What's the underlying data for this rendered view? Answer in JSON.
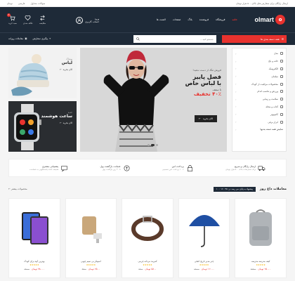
{
  "topbar": {
    "right_text": "ارسال رایگان برای سفارش های بالای ۵۰۰ هزار تومان",
    "currency": "تومان",
    "language": "فارسی",
    "help": "سوالات متداول"
  },
  "header": {
    "logo_badge": "o",
    "logo_text": "olmart",
    "nav": [
      {
        "label": "خانه",
        "hot": true
      },
      {
        "label": "فروشگاه"
      },
      {
        "label": "فروشنده"
      },
      {
        "label": "بلاگ"
      },
      {
        "label": "صفحات"
      },
      {
        "label": "المنت ها"
      }
    ],
    "account_line1": "ورود",
    "account_line2": "حساب کاربری",
    "icons": [
      {
        "name": "compare-icon",
        "label": "مقایسه"
      },
      {
        "name": "wishlist-icon",
        "label": "علاقه مندی"
      },
      {
        "name": "cart-icon",
        "label": "سبد خرید",
        "badge": "0"
      }
    ]
  },
  "searchrow": {
    "category_button": "همه دسته بندی ها",
    "search_placeholder": "جستجو کنید ...",
    "links": [
      "پیگیری سفارش",
      "معاملات روزانه"
    ]
  },
  "categories": [
    "مدل",
    "خانه و باغ",
    "الکترونیک",
    "مبلمان",
    "محصولات مراقبت از کودک",
    "ورزش و تناسب اندام",
    "سلامت و زیبایی",
    "کتاب و مجله",
    "کامپیوتر",
    "ابزار برقی",
    "نمایش همه دسته بندیها"
  ],
  "hero": {
    "subtitle": "فروش مگا، از دست ندهید!",
    "title_line1": "فصل پاییز",
    "title_line2": "با لباس خاص",
    "pct_prefix": "تا سقف",
    "pct_value": "۴۰٪ تخفیف",
    "button": "الان بخرید",
    "active_slide": 1,
    "slides": 3
  },
  "promo1": {
    "small": "پوشاک",
    "big": "لباس",
    "cta": "الان بخرید"
  },
  "promo2": {
    "small": "جدید",
    "big": "ساعت هوشمند",
    "cta": "الان بخرید"
  },
  "features": [
    {
      "title": "ارسال رایگان و سریع",
      "sub": "برای سفارشات بالای ۵۰۰ هزار تومان",
      "icon": "truck-icon"
    },
    {
      "title": "پرداخت امن",
      "sub": "۱۰۰٪ پرداخت امن تضمینی",
      "icon": "lock-icon"
    },
    {
      "title": "ضمانت بازگشت پول",
      "sub": "تا ۳۰ روز بازگشت پول",
      "icon": "refund-icon"
    },
    {
      "title": "پشتیبانی مشتری",
      "sub": "همیشه آماده پاسخگویی به شماست",
      "icon": "support-icon"
    }
  ],
  "deals": {
    "title": "معاملات داغ روز",
    "timer": "پیشنهاد به پایان می رسد در: ۴۵ : ۱۶ : ۱۰",
    "more": "محصولات بیشتر",
    "products": [
      {
        "name": "کیف مدرسه مدرسه",
        "price": "۲۵۰۰۰ تومان",
        "old": "۲۸۵۰۰",
        "img": "backpack"
      },
      {
        "name": "چتر مدیر تاریخ اصلی",
        "price": "۱۲۰۰۰ تومان",
        "old": "۱۵۰۰۰",
        "img": "umbrella"
      },
      {
        "name": "کمربند مردانه چرمی",
        "price": "۵۸۰۰ تومان",
        "old": "۶۲۰۰",
        "img": "belt"
      },
      {
        "name": "اسپیکر بی سیم چوبی",
        "price": "۲۵۰۰ تومان",
        "old": "۴۵۰۰",
        "img": "speaker"
      },
      {
        "name": "بهترین آیپد برای کودک",
        "price": "۷۸۰۰۰ تومان",
        "old": "۸۹۰۰۰",
        "img": "tablet"
      }
    ]
  },
  "colors": {
    "accent": "#e8322e",
    "header": "#1e2a38"
  }
}
